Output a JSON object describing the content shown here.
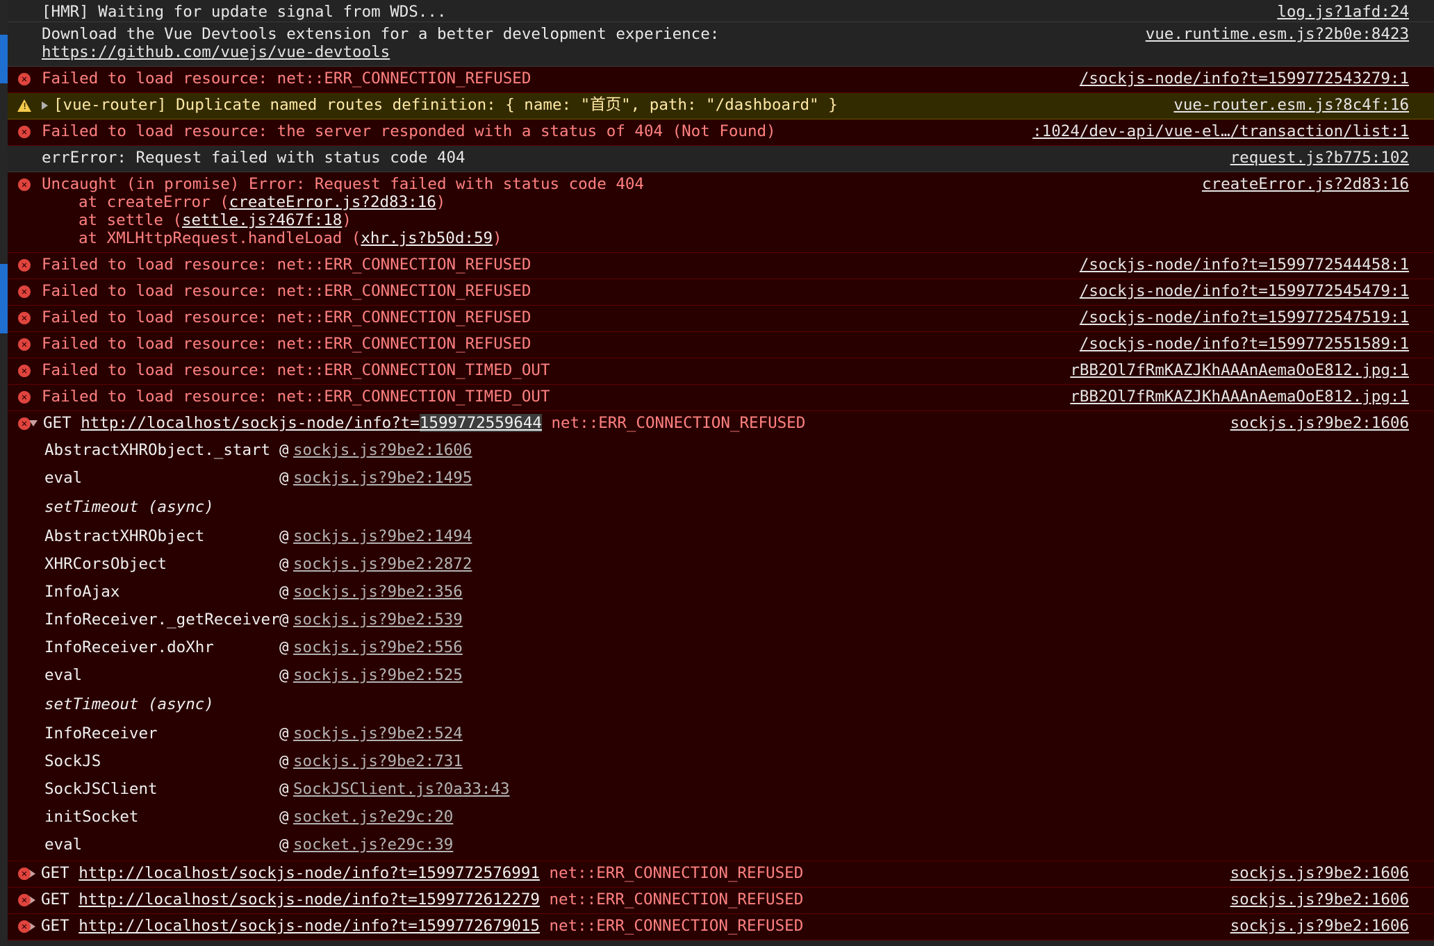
{
  "messages": {
    "m0": {
      "text": "[HMR] Waiting for update signal from WDS...",
      "source": "log.js?1afd:24"
    },
    "m1": {
      "text": "Download the Vue Devtools extension for a better development experience:",
      "link": "https://github.com/vuejs/vue-devtools",
      "source": "vue.runtime.esm.js?2b0e:8423"
    },
    "m2": {
      "text": "Failed to load resource: net::ERR_CONNECTION_REFUSED",
      "source": "/sockjs-node/info?t=1599772543279:1"
    },
    "m3": {
      "text": "[vue-router] Duplicate named routes definition: { name: \"首页\", path: \"/dashboard\" }",
      "source": "vue-router.esm.js?8c4f:16"
    },
    "m4": {
      "text": "Failed to load resource: the server responded with a status of 404 (Not Found)",
      "source": ":1024/dev-api/vue-el…/transaction/list:1"
    },
    "m5": {
      "text": "errError: Request failed with status code 404",
      "source": "request.js?b775:102"
    },
    "m6": {
      "text": "Uncaught (in promise) Error: Request failed with status code 404",
      "source": "createError.js?2d83:16",
      "stack": [
        {
          "prefix": "at createError (",
          "link": "createError.js?2d83:16",
          "suffix": ")"
        },
        {
          "prefix": "at settle (",
          "link": "settle.js?467f:18",
          "suffix": ")"
        },
        {
          "prefix": "at XMLHttpRequest.handleLoad (",
          "link": "xhr.js?b50d:59",
          "suffix": ")"
        }
      ]
    },
    "m7": {
      "text": "Failed to load resource: net::ERR_CONNECTION_REFUSED",
      "source": "/sockjs-node/info?t=1599772544458:1"
    },
    "m8": {
      "text": "Failed to load resource: net::ERR_CONNECTION_REFUSED",
      "source": "/sockjs-node/info?t=1599772545479:1"
    },
    "m9": {
      "text": "Failed to load resource: net::ERR_CONNECTION_REFUSED",
      "source": "/sockjs-node/info?t=1599772547519:1"
    },
    "m10": {
      "text": "Failed to load resource: net::ERR_CONNECTION_REFUSED",
      "source": "/sockjs-node/info?t=1599772551589:1"
    },
    "m11": {
      "text": "Failed to load resource: net::ERR_CONNECTION_TIMED_OUT",
      "source": "rBB2Ol7fRmKAZJKhAAAnAemaOoE812.jpg:1"
    },
    "m12": {
      "text": "Failed to load resource: net::ERR_CONNECTION_TIMED_OUT",
      "source": "rBB2Ol7fRmKAZJKhAAAnAemaOoE812.jpg:1"
    },
    "m13": {
      "method": "GET",
      "url_a": "http://localhost/sockjs-node/info?t=",
      "url_b": "1599772559644",
      "error": "net::ERR_CONNECTION_REFUSED",
      "source": "sockjs.js?9be2:1606",
      "frames": [
        {
          "fn": "AbstractXHRObject._start",
          "at": "@",
          "loc": "sockjs.js?9be2:1606"
        },
        {
          "fn": "eval",
          "at": "@",
          "loc": "sockjs.js?9be2:1495"
        },
        {
          "async": "setTimeout (async)"
        },
        {
          "fn": "AbstractXHRObject",
          "at": "@",
          "loc": "sockjs.js?9be2:1494"
        },
        {
          "fn": "XHRCorsObject",
          "at": "@",
          "loc": "sockjs.js?9be2:2872"
        },
        {
          "fn": "InfoAjax",
          "at": "@",
          "loc": "sockjs.js?9be2:356"
        },
        {
          "fn": "InfoReceiver._getReceiver",
          "at": "@",
          "loc": "sockjs.js?9be2:539"
        },
        {
          "fn": "InfoReceiver.doXhr",
          "at": "@",
          "loc": "sockjs.js?9be2:556"
        },
        {
          "fn": "eval",
          "at": "@",
          "loc": "sockjs.js?9be2:525"
        },
        {
          "async": "setTimeout (async)"
        },
        {
          "fn": "InfoReceiver",
          "at": "@",
          "loc": "sockjs.js?9be2:524"
        },
        {
          "fn": "SockJS",
          "at": "@",
          "loc": "sockjs.js?9be2:731"
        },
        {
          "fn": "SockJSClient",
          "at": "@",
          "loc": "SockJSClient.js?0a33:43"
        },
        {
          "fn": "initSocket",
          "at": "@",
          "loc": "socket.js?e29c:20"
        },
        {
          "fn": "eval",
          "at": "@",
          "loc": "socket.js?e29c:39"
        }
      ]
    },
    "m14": {
      "method": "GET",
      "url": "http://localhost/sockjs-node/info?t=1599772576991",
      "error": "net::ERR_CONNECTION_REFUSED",
      "source": "sockjs.js?9be2:1606"
    },
    "m15": {
      "method": "GET",
      "url": "http://localhost/sockjs-node/info?t=1599772612279",
      "error": "net::ERR_CONNECTION_REFUSED",
      "source": "sockjs.js?9be2:1606"
    },
    "m16": {
      "method": "GET",
      "url": "http://localhost/sockjs-node/info?t=1599772679015",
      "error": "net::ERR_CONNECTION_REFUSED",
      "source": "sockjs.js?9be2:1606"
    }
  }
}
